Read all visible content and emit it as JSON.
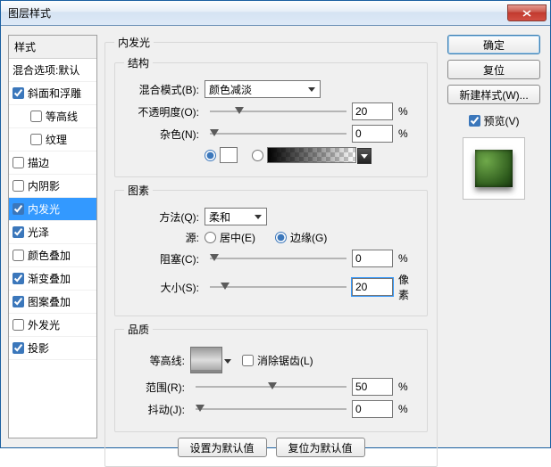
{
  "window": {
    "title": "图层样式"
  },
  "left": {
    "header": "样式",
    "blendopts": "混合选项:默认",
    "items": [
      {
        "label": "斜面和浮雕",
        "checked": true,
        "indent": false
      },
      {
        "label": "等高线",
        "checked": false,
        "indent": true
      },
      {
        "label": "纹理",
        "checked": false,
        "indent": true
      },
      {
        "label": "描边",
        "checked": false,
        "indent": false
      },
      {
        "label": "内阴影",
        "checked": false,
        "indent": false
      },
      {
        "label": "内发光",
        "checked": true,
        "indent": false,
        "selected": true
      },
      {
        "label": "光泽",
        "checked": true,
        "indent": false
      },
      {
        "label": "颜色叠加",
        "checked": false,
        "indent": false
      },
      {
        "label": "渐变叠加",
        "checked": true,
        "indent": false
      },
      {
        "label": "图案叠加",
        "checked": true,
        "indent": false
      },
      {
        "label": "外发光",
        "checked": false,
        "indent": false
      },
      {
        "label": "投影",
        "checked": true,
        "indent": false
      }
    ]
  },
  "panel": {
    "title": "内发光",
    "structure": {
      "legend": "结构",
      "blend_label": "混合模式(B):",
      "blend_value": "颜色减淡",
      "opacity_label": "不透明度(O):",
      "opacity_value": "20",
      "opacity_unit": "%",
      "noise_label": "杂色(N):",
      "noise_value": "0",
      "noise_unit": "%",
      "color_swatch": "#ffffff"
    },
    "elements": {
      "legend": "图素",
      "technique_label": "方法(Q):",
      "technique_value": "柔和",
      "source_label": "源:",
      "source_center": "居中(E)",
      "source_edge": "边缘(G)",
      "choke_label": "阻塞(C):",
      "choke_value": "0",
      "choke_unit": "%",
      "size_label": "大小(S):",
      "size_value": "20",
      "size_unit": "像素"
    },
    "quality": {
      "legend": "品质",
      "contour_label": "等高线:",
      "antialias_label": "消除锯齿(L)",
      "range_label": "范围(R):",
      "range_value": "50",
      "range_unit": "%",
      "jitter_label": "抖动(J):",
      "jitter_value": "0",
      "jitter_unit": "%"
    },
    "footer": {
      "make_default": "设置为默认值",
      "reset_default": "复位为默认值"
    }
  },
  "right": {
    "ok": "确定",
    "cancel": "复位",
    "newstyle": "新建样式(W)...",
    "preview_label": "预览(V)"
  }
}
